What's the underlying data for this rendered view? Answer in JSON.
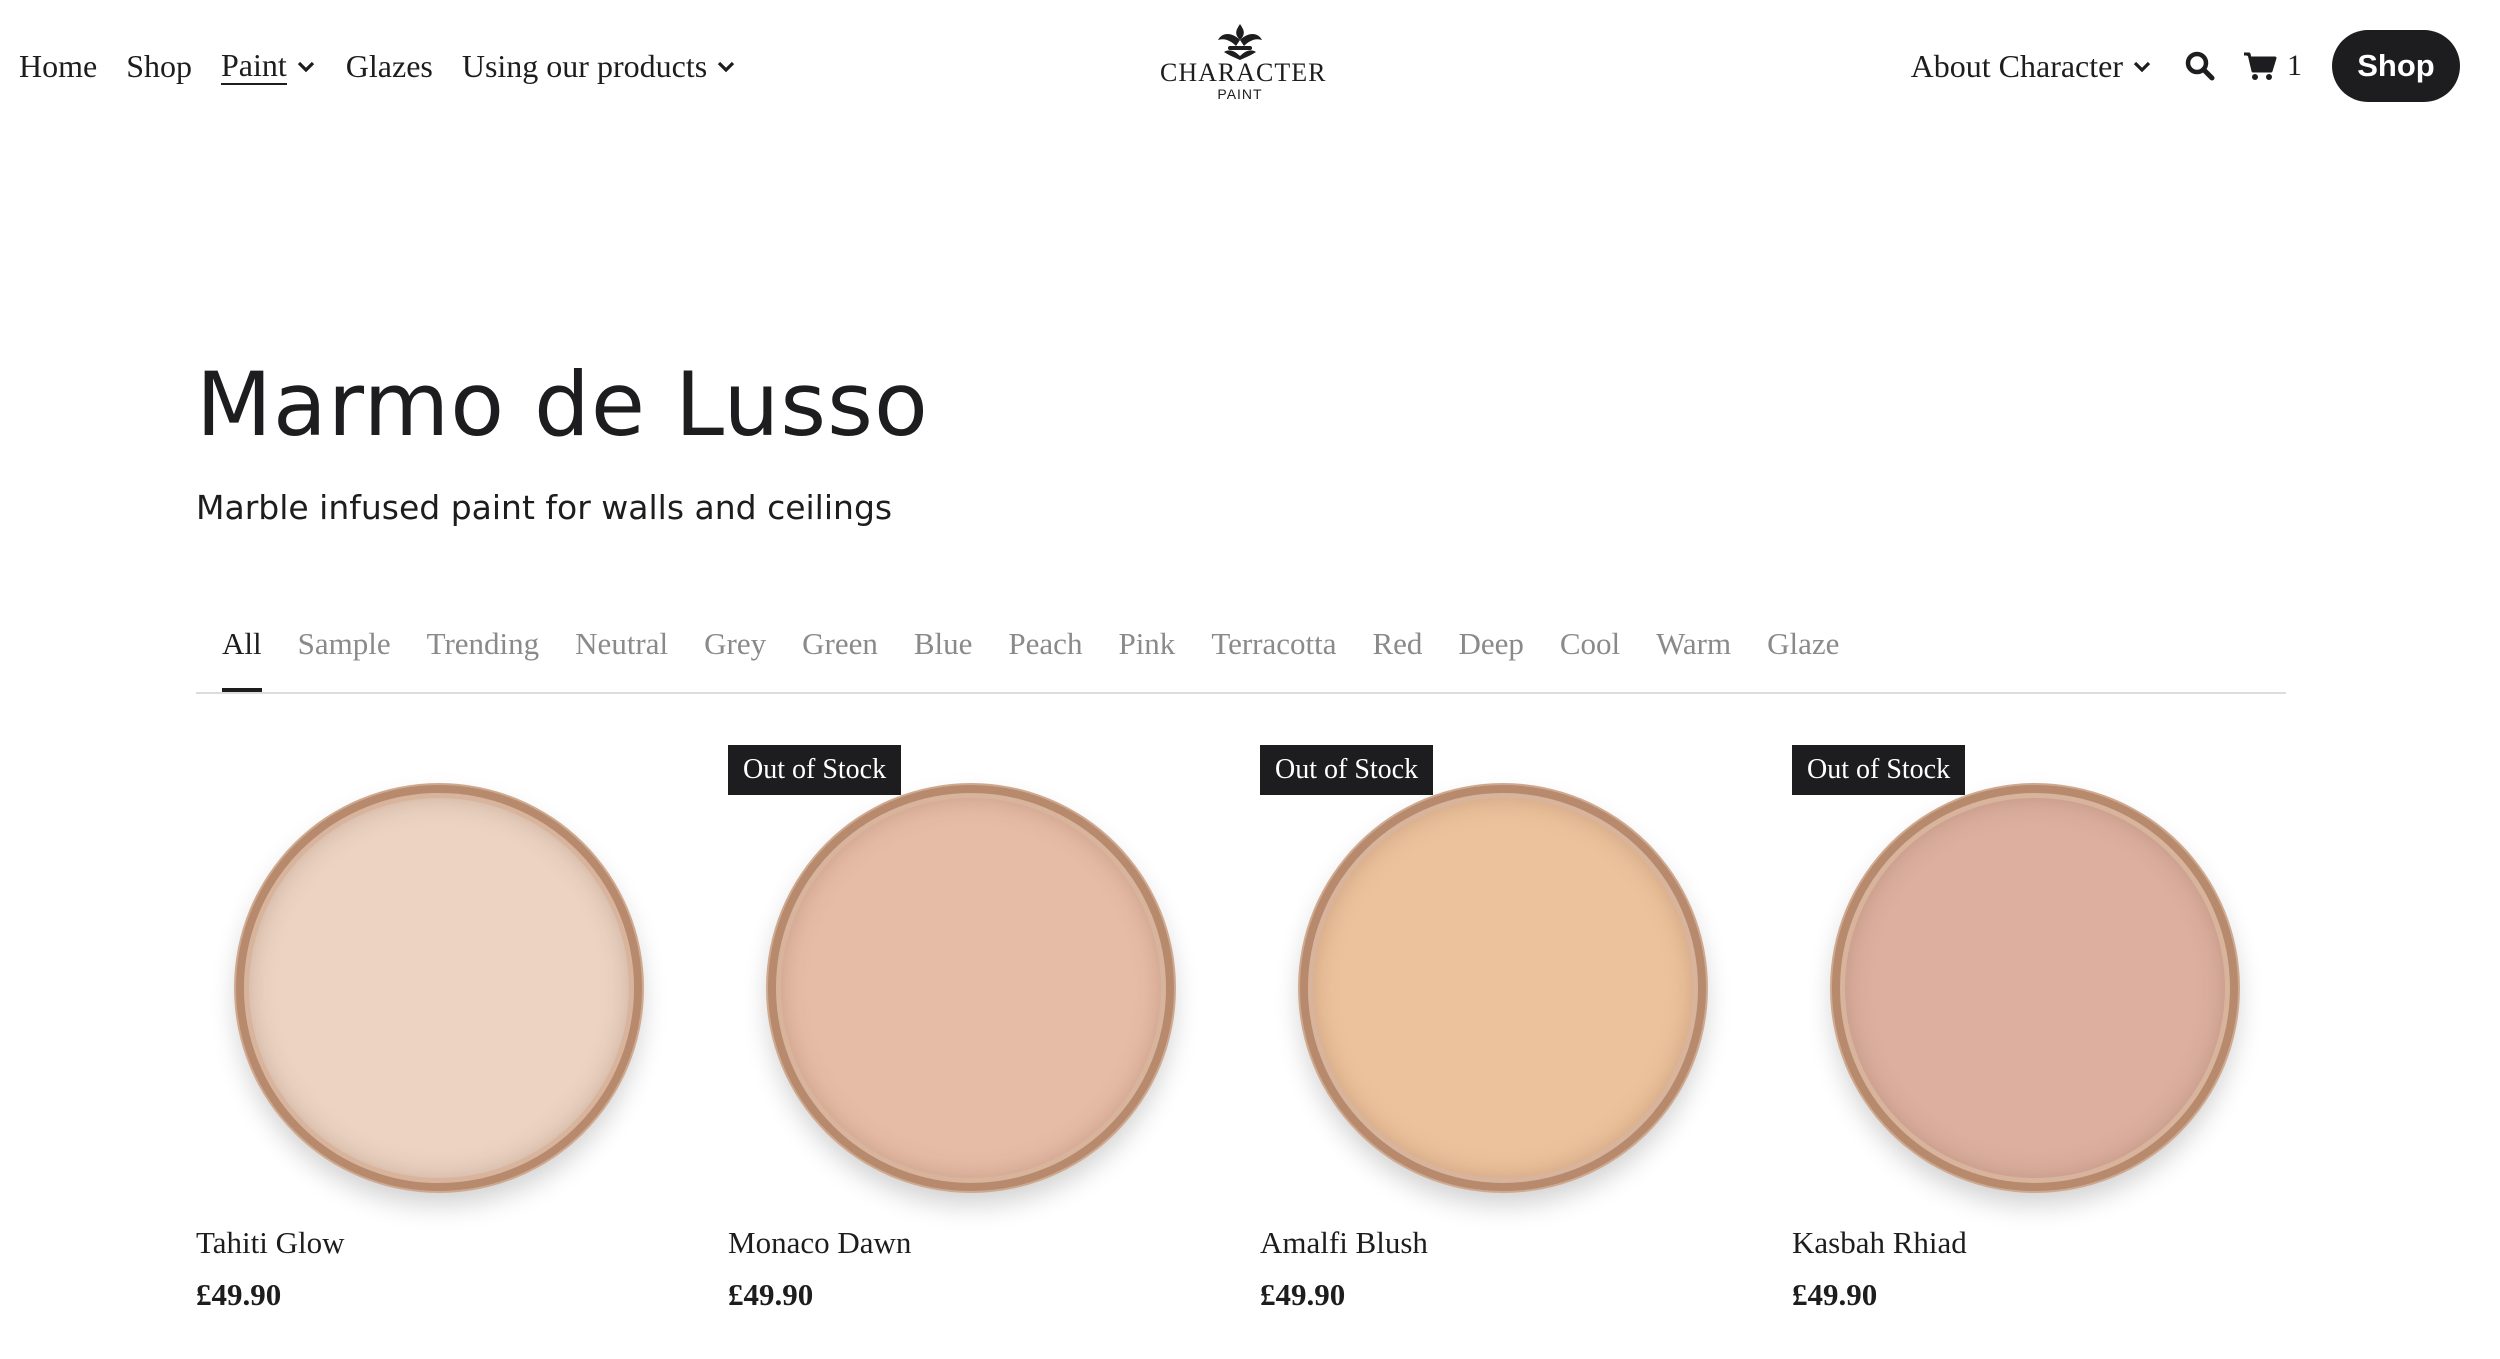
{
  "nav": {
    "left": [
      {
        "label": "Home",
        "dropdown": false,
        "active": false
      },
      {
        "label": "Shop",
        "dropdown": false,
        "active": false
      },
      {
        "label": "Paint",
        "dropdown": true,
        "active": true
      },
      {
        "label": "Glazes",
        "dropdown": false,
        "active": false
      },
      {
        "label": "Using our products",
        "dropdown": true,
        "active": false
      }
    ],
    "logo": {
      "name": "CHARACTER",
      "sub": "PAINT"
    },
    "about_label": "About Character",
    "search_icon": "search-icon",
    "cart_icon": "cart-icon",
    "cart_count": "1",
    "shop_button": "Shop"
  },
  "hero": {
    "title": "Marmo de Lusso",
    "subtitle": "Marble infused paint for walls and ceilings"
  },
  "filters": {
    "tabs": [
      "All",
      "Sample",
      "Trending",
      "Neutral",
      "Grey",
      "Green",
      "Blue",
      "Peach",
      "Pink",
      "Terracotta",
      "Red",
      "Deep",
      "Cool",
      "Warm",
      "Glaze"
    ],
    "selected": "All"
  },
  "products": [
    {
      "name": "Tahiti Glow",
      "price": "£49.90",
      "badge": "",
      "color": "#ecd3c2"
    },
    {
      "name": "Monaco Dawn",
      "price": "£49.90",
      "badge": "Out of Stock",
      "color": "#e6bca6"
    },
    {
      "name": "Amalfi Blush",
      "price": "£49.90",
      "badge": "Out of Stock",
      "color": "#ecc29c"
    },
    {
      "name": "Kasbah Rhiad",
      "price": "£49.90",
      "badge": "Out of Stock",
      "color": "#dcaf9f"
    }
  ],
  "colors": {
    "text": "#1d1d1f",
    "muted_tab": "#8a8a8a",
    "button_bg": "#1d1d1f",
    "tin_rim": "#b88a6d"
  }
}
